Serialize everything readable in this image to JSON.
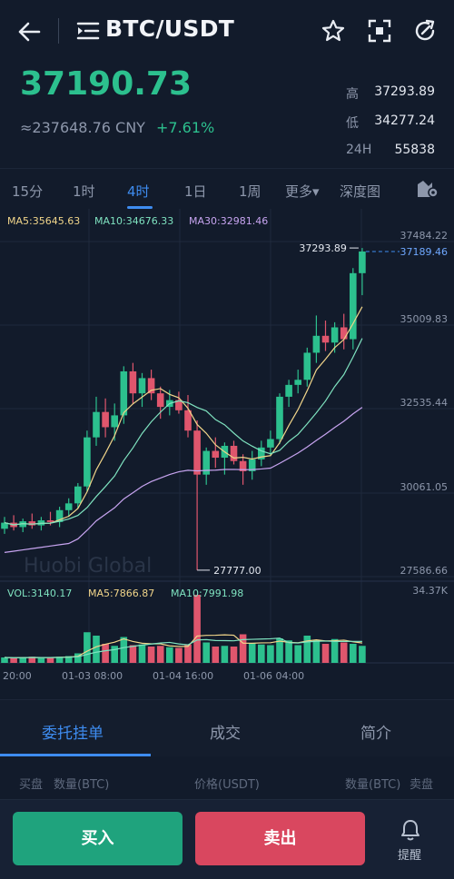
{
  "header": {
    "title": "BTC/USDT",
    "icons": [
      "back-arrow-icon",
      "menu-list-icon",
      "star-icon",
      "scan-icon",
      "refresh-icon"
    ]
  },
  "ticker": {
    "last_price": "37190.73",
    "cny_value": "≈237648.76 CNY",
    "change": "+7.61%",
    "high_label": "高",
    "high": "37293.89",
    "low_label": "低",
    "low": "34277.24",
    "vol_label": "24H",
    "vol": "55838"
  },
  "intervals": [
    "15分",
    "1时",
    "4时",
    "1日",
    "1周",
    "更多▾",
    "深度图"
  ],
  "active_interval": "4时",
  "indicators": {
    "ma5": "MA5:35645.63",
    "ma10": "MA10:34676.33",
    "ma30": "MA30:32981.46",
    "vol": "VOL:3140.17",
    "vol_ma5": "MA5:7866.87",
    "vol_ma10": "MA10:7991.98"
  },
  "colors": {
    "up": "#2cc08e",
    "down": "#e0566d",
    "ma5": "#f1d58a",
    "ma10": "#7fe3c0",
    "ma30": "#c7a4f0",
    "accent": "#3e8cf0"
  },
  "chart_data": {
    "type": "candlestick",
    "y_ticks": [
      "37484.22",
      "35009.83",
      "32535.44",
      "30061.05",
      "27586.66"
    ],
    "vol_max_label": "34.37K",
    "x_ticks": [
      "20:00",
      "01-03 08:00",
      "01-04 16:00",
      "01-06 04:00"
    ],
    "high_annotation": "37293.89",
    "low_annotation": "27777.00",
    "last_price_label": "37189.46",
    "watermark": "Huobi Global",
    "ylim": [
      27586.66,
      37484.22
    ],
    "candles": [
      {
        "o": 29000,
        "h": 29350,
        "l": 28850,
        "c": 29180
      },
      {
        "o": 29180,
        "h": 29400,
        "l": 28950,
        "c": 29050
      },
      {
        "o": 29050,
        "h": 29300,
        "l": 28900,
        "c": 29220
      },
      {
        "o": 29220,
        "h": 29450,
        "l": 29000,
        "c": 29100
      },
      {
        "o": 29100,
        "h": 29350,
        "l": 28950,
        "c": 29250
      },
      {
        "o": 29250,
        "h": 29500,
        "l": 29100,
        "c": 29200
      },
      {
        "o": 29200,
        "h": 29650,
        "l": 29050,
        "c": 29550
      },
      {
        "o": 29550,
        "h": 29900,
        "l": 29350,
        "c": 29750
      },
      {
        "o": 29750,
        "h": 30350,
        "l": 29600,
        "c": 30250
      },
      {
        "o": 30250,
        "h": 31900,
        "l": 30100,
        "c": 31700
      },
      {
        "o": 31700,
        "h": 32900,
        "l": 31450,
        "c": 32450
      },
      {
        "o": 32450,
        "h": 32850,
        "l": 31700,
        "c": 32000
      },
      {
        "o": 32000,
        "h": 32700,
        "l": 31600,
        "c": 32350
      },
      {
        "o": 32350,
        "h": 33800,
        "l": 32100,
        "c": 33650
      },
      {
        "o": 33650,
        "h": 33900,
        "l": 32700,
        "c": 33000
      },
      {
        "o": 33000,
        "h": 33600,
        "l": 32600,
        "c": 33450
      },
      {
        "o": 33450,
        "h": 33700,
        "l": 32800,
        "c": 33000
      },
      {
        "o": 33000,
        "h": 33200,
        "l": 32250,
        "c": 32600
      },
      {
        "o": 32600,
        "h": 33100,
        "l": 32350,
        "c": 32800
      },
      {
        "o": 32800,
        "h": 33050,
        "l": 32400,
        "c": 32500
      },
      {
        "o": 32500,
        "h": 32950,
        "l": 31700,
        "c": 31900
      },
      {
        "o": 31900,
        "h": 32200,
        "l": 27777,
        "c": 30600
      },
      {
        "o": 30600,
        "h": 31400,
        "l": 30300,
        "c": 31300
      },
      {
        "o": 31300,
        "h": 31700,
        "l": 30800,
        "c": 31100
      },
      {
        "o": 31100,
        "h": 31550,
        "l": 30600,
        "c": 31450
      },
      {
        "o": 31450,
        "h": 31600,
        "l": 30900,
        "c": 31000
      },
      {
        "o": 31000,
        "h": 31200,
        "l": 30300,
        "c": 30700
      },
      {
        "o": 30700,
        "h": 31300,
        "l": 30450,
        "c": 31050
      },
      {
        "o": 31050,
        "h": 31600,
        "l": 30850,
        "c": 31400
      },
      {
        "o": 31400,
        "h": 31900,
        "l": 31150,
        "c": 31650
      },
      {
        "o": 31650,
        "h": 33000,
        "l": 31500,
        "c": 32900
      },
      {
        "o": 32900,
        "h": 33400,
        "l": 32600,
        "c": 33250
      },
      {
        "o": 33250,
        "h": 33700,
        "l": 33000,
        "c": 33400
      },
      {
        "o": 33400,
        "h": 34350,
        "l": 33200,
        "c": 34200
      },
      {
        "o": 34200,
        "h": 35300,
        "l": 33900,
        "c": 34700
      },
      {
        "o": 34700,
        "h": 35150,
        "l": 34250,
        "c": 34500
      },
      {
        "o": 34500,
        "h": 35100,
        "l": 34200,
        "c": 34950
      },
      {
        "o": 34950,
        "h": 35350,
        "l": 34300,
        "c": 34600
      },
      {
        "o": 34600,
        "h": 36700,
        "l": 34300,
        "c": 36550
      },
      {
        "o": 36550,
        "h": 37293.89,
        "l": 35900,
        "c": 37190.73
      }
    ],
    "volumes": [
      0.08,
      0.07,
      0.08,
      0.09,
      0.07,
      0.08,
      0.09,
      0.1,
      0.14,
      0.45,
      0.4,
      0.28,
      0.25,
      0.38,
      0.26,
      0.27,
      0.24,
      0.25,
      0.23,
      0.22,
      0.27,
      1.0,
      0.3,
      0.24,
      0.25,
      0.24,
      0.42,
      0.29,
      0.27,
      0.26,
      0.36,
      0.33,
      0.26,
      0.4,
      0.34,
      0.28,
      0.35,
      0.3,
      0.28,
      0.25
    ]
  },
  "orderbook_tabs": [
    "委托挂单",
    "成交",
    "简介"
  ],
  "orderbook_header": {
    "buy_side": "买盘",
    "buy_qty": "数量(BTC)",
    "price": "价格(USDT)",
    "sell_qty": "数量(BTC)",
    "sell_side": "卖盘"
  },
  "actions": {
    "buy": "买入",
    "sell": "卖出",
    "alert": "提醒"
  }
}
